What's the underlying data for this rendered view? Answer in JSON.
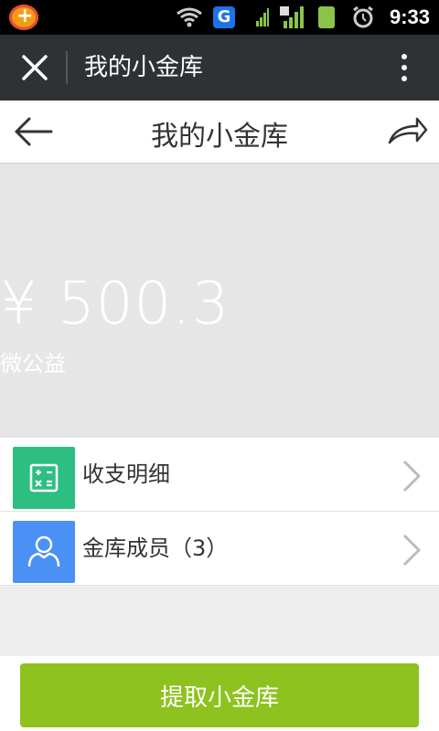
{
  "status_bar": {
    "time": "9:33"
  },
  "app_bar": {
    "title": "我的小金库"
  },
  "page": {
    "title": "我的小金库",
    "amount": "¥ 500.3",
    "amount_label": "微公益"
  },
  "menu": [
    {
      "label": "收支明细",
      "icon": "calculator-icon",
      "color": "#2dbe82"
    },
    {
      "label": "金库成员（3）",
      "icon": "user-icon",
      "color": "#4b90f5"
    }
  ],
  "actions": {
    "withdraw": "提取小金库"
  },
  "colors": {
    "status_bg": "#000000",
    "appbar_bg": "#2f3234",
    "banner_bg": "#e6e6e6",
    "button_bg": "#8dc21f"
  }
}
